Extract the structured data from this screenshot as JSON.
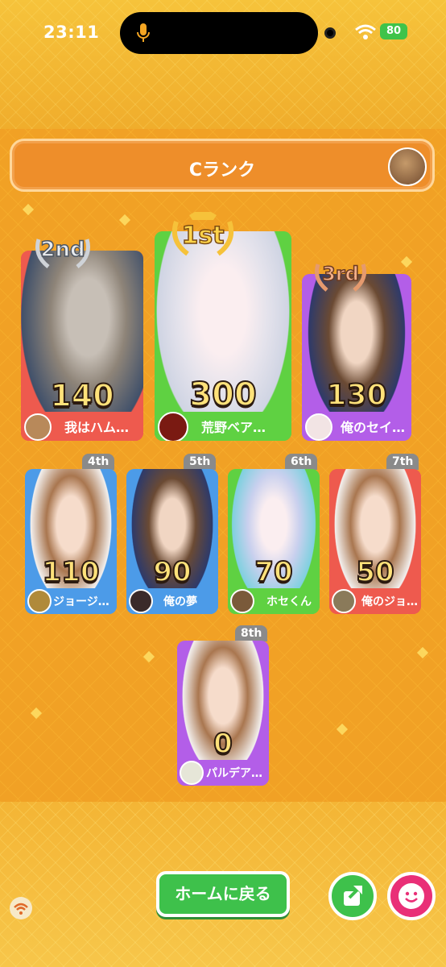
{
  "status_bar": {
    "time": "23:11",
    "battery": "80"
  },
  "header": {
    "rank_title": "Cランク"
  },
  "podium": [
    {
      "place_label": "2nd",
      "score": "140",
      "name": "我はハム…"
    },
    {
      "place_label": "1st",
      "score": "300",
      "name": "荒野ベア…"
    },
    {
      "place_label": "3rd",
      "score": "130",
      "name": "俺のセイ…"
    }
  ],
  "others": [
    {
      "place_label": "4th",
      "score": "110",
      "name": "ジョージ…"
    },
    {
      "place_label": "5th",
      "score": "90",
      "name": "俺の夢"
    },
    {
      "place_label": "6th",
      "score": "70",
      "name": "ホセくん"
    },
    {
      "place_label": "7th",
      "score": "50",
      "name": "俺のジョ…"
    },
    {
      "place_label": "8th",
      "score": "0",
      "name": "パルデア…"
    }
  ],
  "buttons": {
    "home": "ホームに戻る"
  },
  "colors": {
    "red": "#ee5a4e",
    "green": "#5fd142",
    "purple": "#b35ee8",
    "blue": "#4c9be8",
    "orange_bg": "#f1a125"
  }
}
